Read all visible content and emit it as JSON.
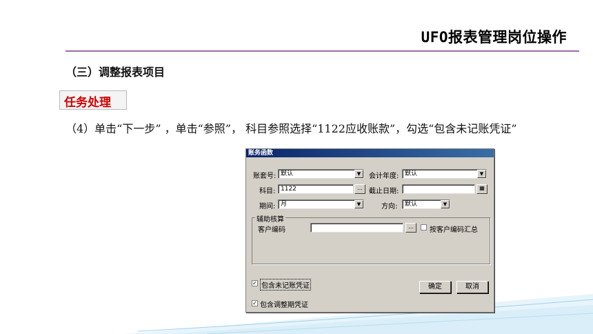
{
  "slide": {
    "title": "UFO报表管理岗位操作",
    "section_heading": "（三）调整报表项目",
    "task_label": "任务处理",
    "instruction": "（4）单击“下一步” ，单击“参照”， 科目参照选择“1122应收账款”，勾选“包含未记账凭证”"
  },
  "colors": {
    "rule": "#9b6aa8",
    "task_text": "#d10000",
    "dialog_bg": "#d4d0c8"
  },
  "dialog": {
    "title": "账务函数",
    "account_set_label": "账套号:",
    "account_set_value": "默认",
    "fiscal_year_label": "会计年度:",
    "fiscal_year_value": "默认",
    "subject_label": "科目:",
    "subject_value": "1122",
    "end_date_label": "截止日期:",
    "end_date_value": "",
    "period_label": "期间:",
    "period_value": "月",
    "direction_label": "方向:",
    "direction_value": "默认",
    "aux_group_label": "辅助核算",
    "customer_code_label": "客户编码",
    "customer_code_value": "",
    "summarize_by_code_label": "按客户编码汇总",
    "include_unposted_label": "包含未记账凭证",
    "include_adjustment_label": "包含调整期凭证",
    "ok_label": "确定",
    "cancel_label": "取消",
    "ellipsis": "...",
    "check_mark": "✓",
    "dropdown_glyph": "▼",
    "calendar_glyph": "▦"
  }
}
